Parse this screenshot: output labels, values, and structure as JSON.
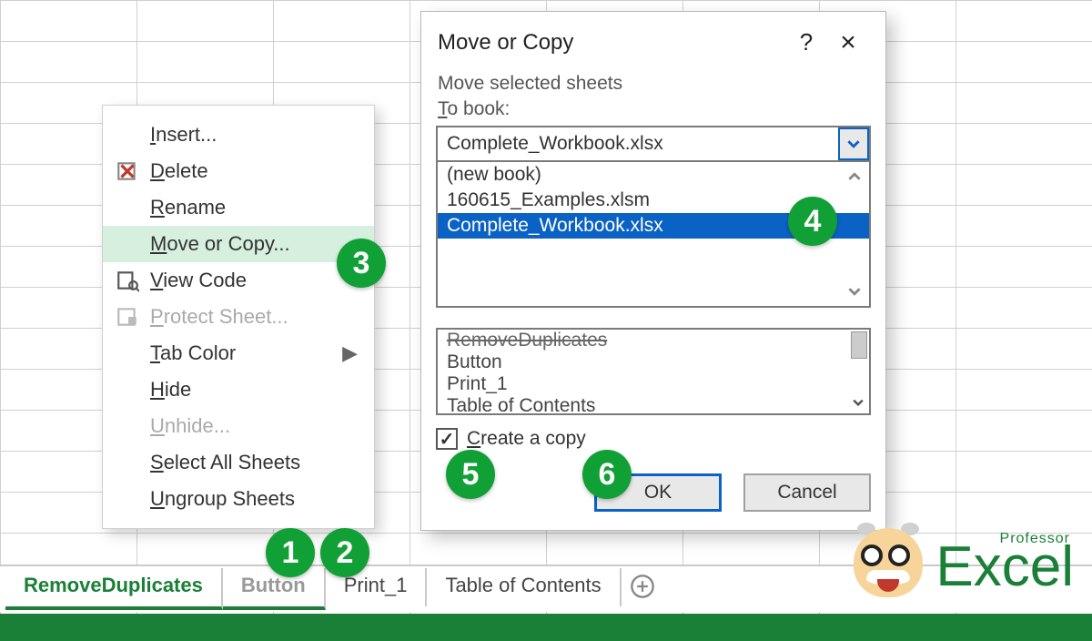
{
  "context_menu": {
    "items": [
      {
        "label": "Insert...",
        "underline": "I",
        "icon": null,
        "enabled": true
      },
      {
        "label": "Delete",
        "underline": "D",
        "icon": "delete-sheet-icon",
        "enabled": true
      },
      {
        "label": "Rename",
        "underline": "R",
        "icon": null,
        "enabled": true
      },
      {
        "label": "Move or Copy...",
        "underline": "M",
        "icon": null,
        "enabled": true,
        "highlight": true
      },
      {
        "label": "View Code",
        "underline": "V",
        "icon": "view-code-icon",
        "enabled": true
      },
      {
        "label": "Protect Sheet...",
        "underline": "P",
        "icon": "protect-sheet-icon",
        "enabled": false
      },
      {
        "label": "Tab Color",
        "underline": "T",
        "icon": null,
        "enabled": true,
        "submenu": true
      },
      {
        "label": "Hide",
        "underline": "H",
        "icon": null,
        "enabled": true
      },
      {
        "label": "Unhide...",
        "underline": "U",
        "icon": null,
        "enabled": false
      },
      {
        "label": "Select All Sheets",
        "underline": "S",
        "icon": null,
        "enabled": true
      },
      {
        "label": "Ungroup Sheets",
        "underline": "U",
        "icon": null,
        "enabled": true
      }
    ]
  },
  "dialog": {
    "title": "Move or Copy",
    "help": "?",
    "close": "×",
    "move_label": "Move selected sheets",
    "to_book_label": "To book:",
    "combo_value": "Complete_Workbook.xlsx",
    "book_options": [
      "(new book)",
      "160615_Examples.xlsm",
      "Complete_Workbook.xlsx"
    ],
    "selected_book_index": 2,
    "sheet_list": [
      {
        "label": "RemoveDuplicates",
        "struck": true
      },
      {
        "label": "Button",
        "struck": false
      },
      {
        "label": "Print_1",
        "struck": false
      },
      {
        "label": "Table of Contents",
        "struck": false
      }
    ],
    "checkbox_label": "Create a copy",
    "checkbox_checked": true,
    "ok_label": "OK",
    "cancel_label": "Cancel"
  },
  "tabs": [
    {
      "label": "RemoveDuplicates",
      "active": true,
      "dim": false
    },
    {
      "label": "Button",
      "active": true,
      "dim": true
    },
    {
      "label": "Print_1",
      "active": false,
      "dim": false
    },
    {
      "label": "Table of Contents",
      "active": false,
      "dim": false
    }
  ],
  "badges": {
    "b1": "1",
    "b2": "2",
    "b3": "3",
    "b4": "4",
    "b5": "5",
    "b6": "6"
  },
  "logo": {
    "professor": "Professor",
    "excel": "Excel"
  }
}
